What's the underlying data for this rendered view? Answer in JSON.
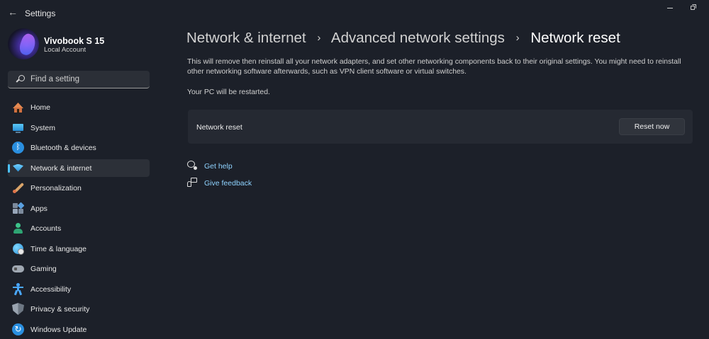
{
  "window": {
    "app_title": "Settings"
  },
  "profile": {
    "name": "Vivobook S 15",
    "account_type": "Local Account"
  },
  "search": {
    "placeholder": "Find a setting"
  },
  "sidebar": {
    "items": [
      {
        "label": "Home",
        "icon": "home-icon"
      },
      {
        "label": "System",
        "icon": "monitor-icon"
      },
      {
        "label": "Bluetooth & devices",
        "icon": "bluetooth-icon"
      },
      {
        "label": "Network & internet",
        "icon": "wifi-icon",
        "active": true
      },
      {
        "label": "Personalization",
        "icon": "brush-icon"
      },
      {
        "label": "Apps",
        "icon": "apps-icon"
      },
      {
        "label": "Accounts",
        "icon": "person-icon"
      },
      {
        "label": "Time & language",
        "icon": "globe-clock-icon"
      },
      {
        "label": "Gaming",
        "icon": "gamepad-icon"
      },
      {
        "label": "Accessibility",
        "icon": "accessibility-icon"
      },
      {
        "label": "Privacy & security",
        "icon": "shield-icon"
      },
      {
        "label": "Windows Update",
        "icon": "update-icon"
      }
    ]
  },
  "breadcrumb": {
    "items": [
      "Network & internet",
      "Advanced network settings"
    ],
    "current": "Network reset",
    "separator": "›"
  },
  "main": {
    "description": "This will remove then reinstall all your network adapters, and set other networking components back to their original settings. You might need to reinstall other networking software afterwards, such as VPN client software or virtual switches.",
    "restart_note": "Your PC will be restarted.",
    "card": {
      "label": "Network reset",
      "button_label": "Reset now"
    },
    "links": {
      "help": "Get help",
      "feedback": "Give feedback"
    }
  },
  "colors": {
    "background": "#1c2029",
    "accent": "#4cc2ff",
    "link": "#8fd3ff"
  }
}
